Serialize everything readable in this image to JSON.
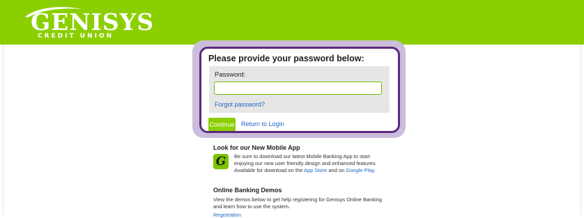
{
  "brand": {
    "name": "GENISYS",
    "tagline": "CREDIT UNION",
    "color": "#8ccf00"
  },
  "login": {
    "title": "Please provide your password below:",
    "password_label": "Password:",
    "password_value": "",
    "forgot_link": "Forgot password?",
    "continue_label": "Continue",
    "return_link": "Return to Login"
  },
  "mobile_app": {
    "heading": "Look for our New Mobile App",
    "icon_letter": "G",
    "text_before": "Be sure to download our latest Mobile Banking App to start enjoying our new user friendly design and enhanced features. Available for download on the ",
    "app_store": "App Store",
    "text_mid": " and on ",
    "google_play": "Google Play",
    "text_end": "."
  },
  "demos": {
    "heading": "Online Banking Demos",
    "text": "View the demos below to get help registering for Genisys Online Banking and learn how to use the system.",
    "link_registration": "Registration"
  }
}
